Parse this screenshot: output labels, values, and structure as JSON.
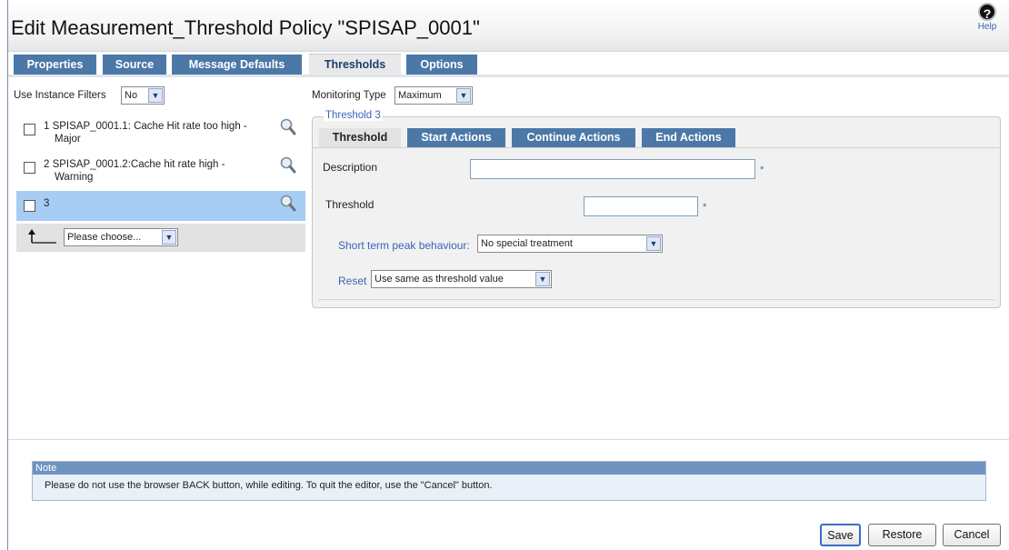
{
  "header": {
    "title": "Edit Measurement_Threshold Policy \"SPISAP_0001\"",
    "help_label": "Help"
  },
  "tabs": [
    {
      "label": "Properties"
    },
    {
      "label": "Source"
    },
    {
      "label": "Message Defaults"
    },
    {
      "label": "Thresholds",
      "active": true
    },
    {
      "label": "Options"
    }
  ],
  "instance_filters": {
    "label": "Use Instance Filters",
    "value": "No"
  },
  "monitoring_type": {
    "label": "Monitoring Type",
    "value": "Maximum"
  },
  "threshold_list": [
    {
      "line1": "1 SPISAP_0001.1: Cache Hit rate too high -",
      "line2": "Major"
    },
    {
      "line1": "2 SPISAP_0001.2:Cache hit rate high -",
      "line2": "Warning"
    },
    {
      "line1": "3",
      "line2": "",
      "selected": true
    }
  ],
  "move_select": {
    "value": "Please choose..."
  },
  "threshold_panel": {
    "legend": "Threshold 3",
    "tabs": [
      {
        "label": "Threshold",
        "active": true
      },
      {
        "label": "Start Actions"
      },
      {
        "label": "Continue Actions"
      },
      {
        "label": "End Actions"
      }
    ],
    "description_label": "Description",
    "description_value": "",
    "threshold_label": "Threshold",
    "threshold_value": "",
    "required_mark": "*",
    "short_term_label": "Short term peak behaviour:",
    "short_term_value": "No special treatment",
    "reset_label": "Reset",
    "reset_value": "Use same as threshold value"
  },
  "note": {
    "heading": "Note",
    "text": "Please do not use the browser BACK button, while editing. To quit the editor, use the \"Cancel\" button."
  },
  "buttons": {
    "save": "Save",
    "restore": "Restore",
    "cancel": "Cancel"
  }
}
